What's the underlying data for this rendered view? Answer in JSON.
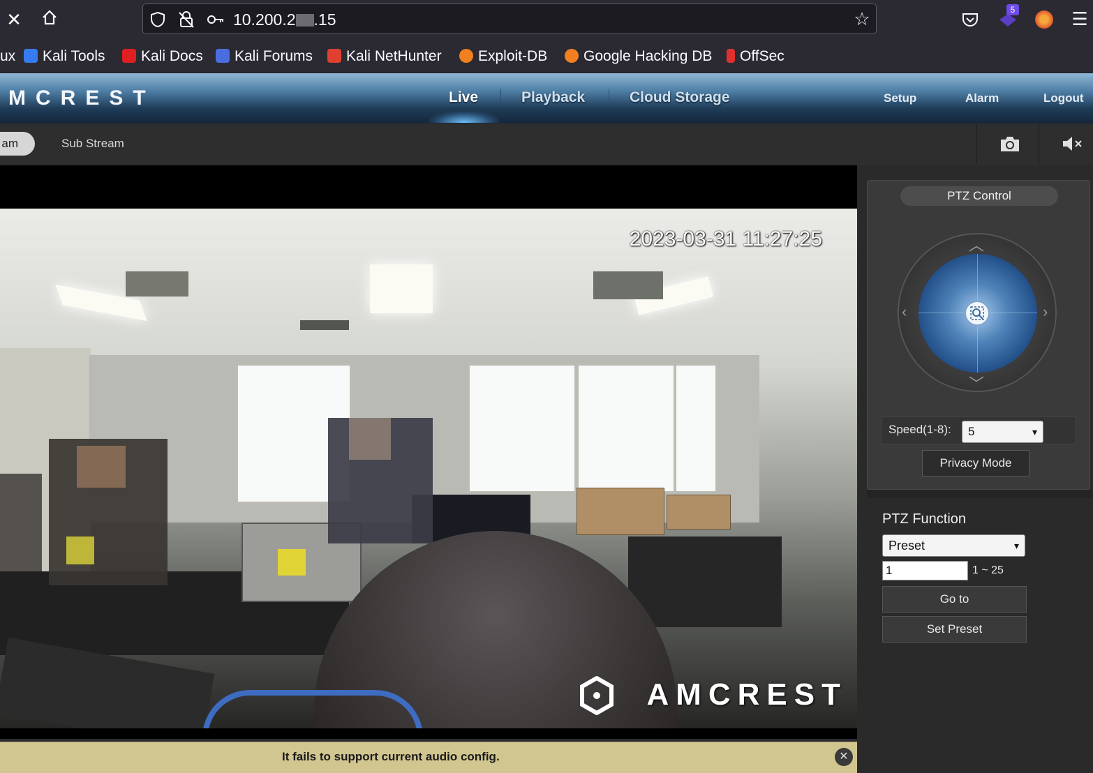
{
  "browser": {
    "url": {
      "prefix": "10.200.2",
      "suffix": ".15"
    },
    "bookmarks": [
      {
        "label": "ux",
        "color": ""
      },
      {
        "label": "Kali Tools",
        "color": "#367bf0"
      },
      {
        "label": "Kali Docs",
        "color": "#e02020"
      },
      {
        "label": "Kali Forums",
        "color": "#4a6ee0"
      },
      {
        "label": "Kali NetHunter",
        "color": "#e04030"
      },
      {
        "label": "Exploit-DB",
        "color": "#f08020"
      },
      {
        "label": "Google Hacking DB",
        "color": "#f08020"
      },
      {
        "label": "OffSec",
        "color": "#e03030"
      }
    ],
    "extension_badge": "5"
  },
  "app": {
    "logo": "MCREST",
    "nav": {
      "live": "Live",
      "playback": "Playback",
      "cloud": "Cloud Storage",
      "setup": "Setup",
      "alarm": "Alarm",
      "logout": "Logout"
    },
    "accent_color": "#6fc2ff"
  },
  "stream": {
    "main_partial": "am",
    "sub": "Sub Stream"
  },
  "video": {
    "timestamp": "2023-03-31 11:27:25",
    "watermark": "AMCREST",
    "audio_notice": "It fails to support current audio config."
  },
  "ptz": {
    "title": "PTZ Control",
    "speed_label": "Speed(1-8):",
    "speed_value": "5",
    "privacy_mode": "Privacy Mode",
    "function_label": "PTZ Function",
    "function_value": "Preset",
    "preset_value": "1",
    "preset_range": "1 ~ 25",
    "goto": "Go to",
    "set_preset": "Set Preset"
  }
}
